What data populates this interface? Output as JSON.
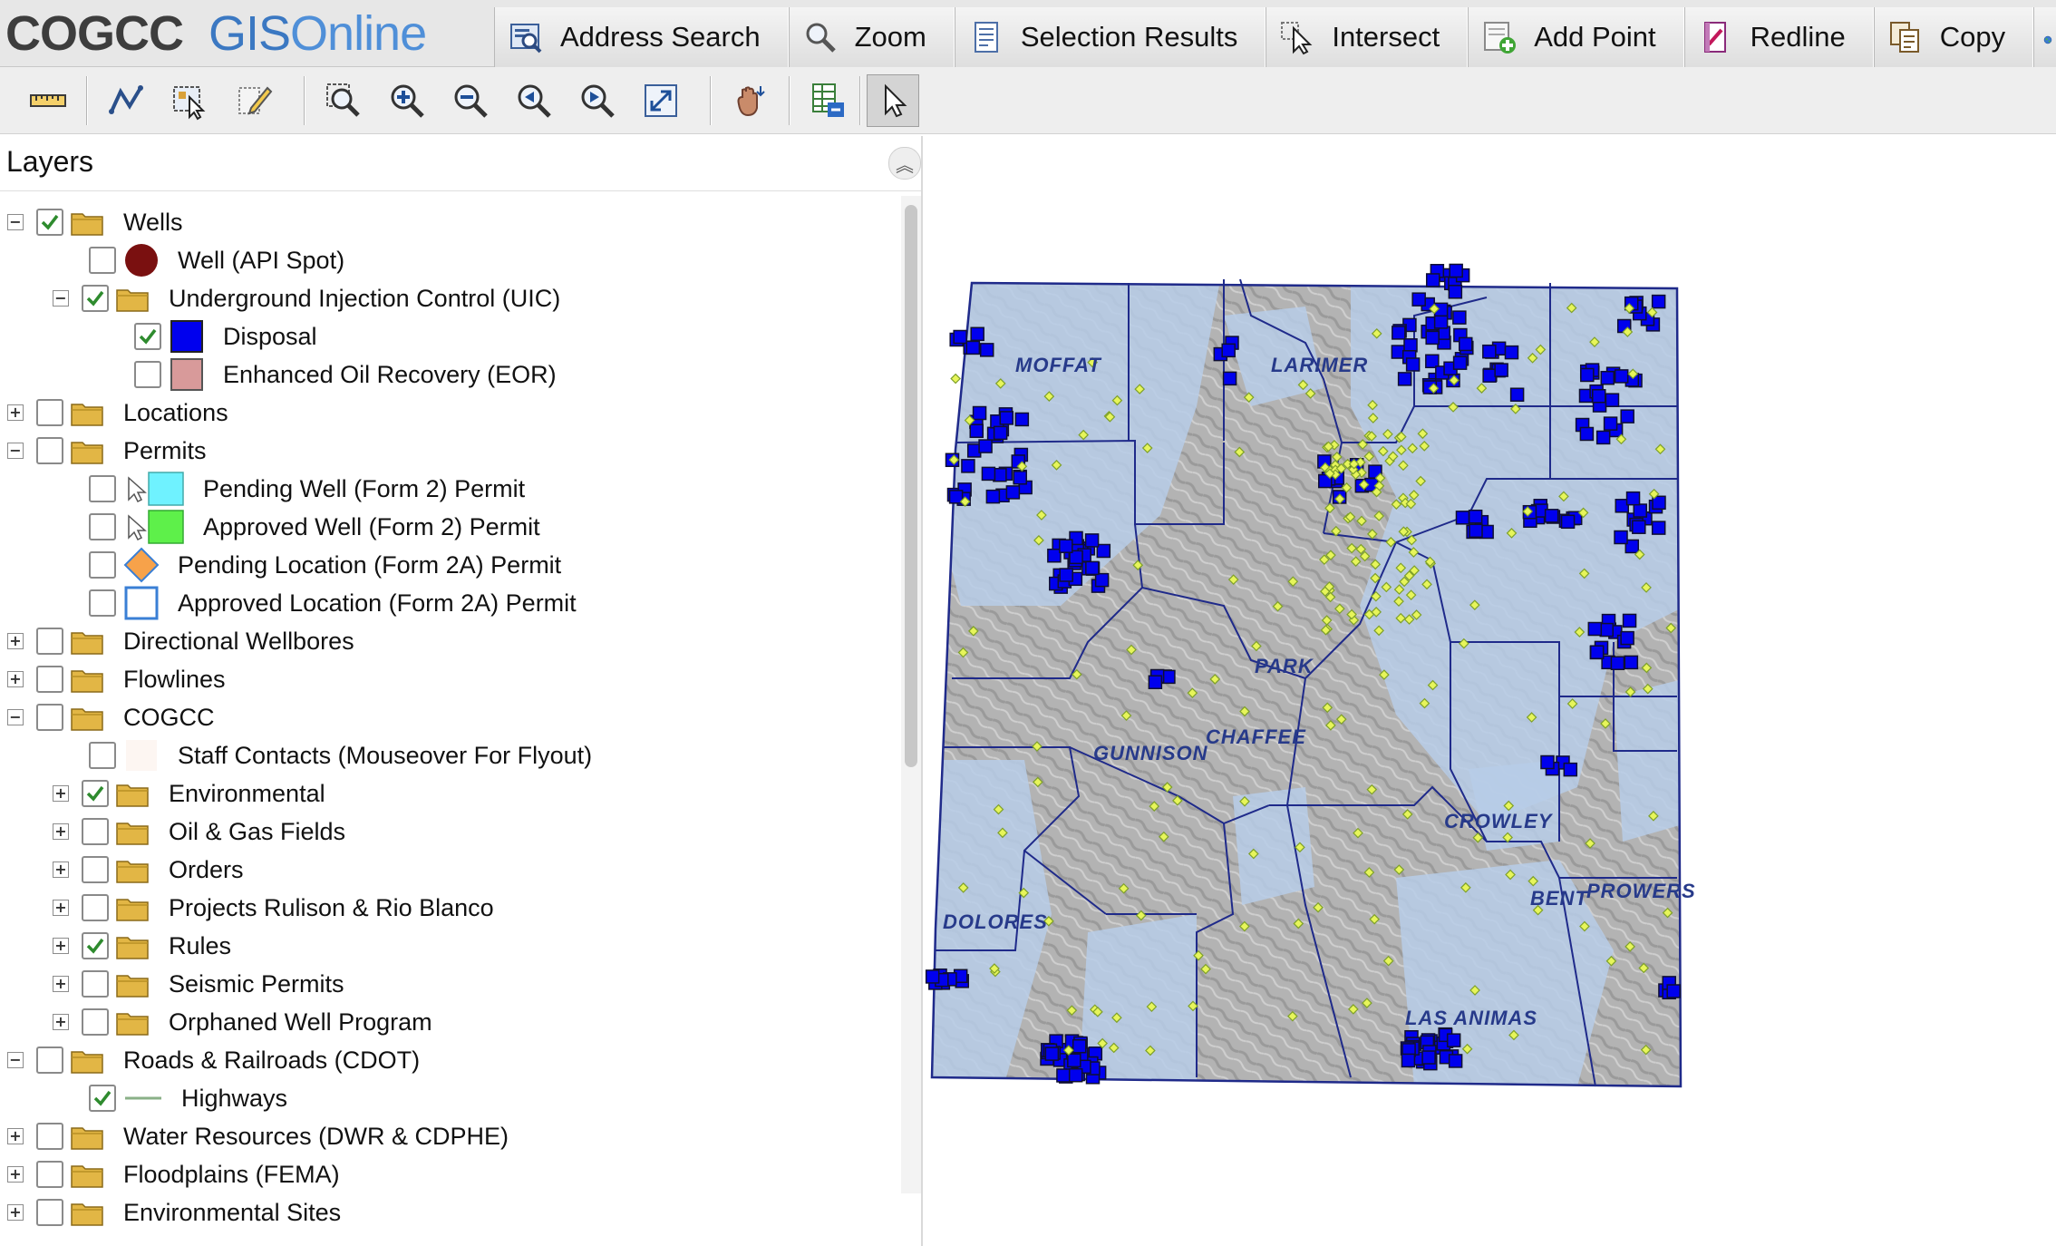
{
  "app": {
    "logo_part1": "COGCC",
    "logo_part2": "GIS",
    "logo_part3": "Online"
  },
  "menu": [
    {
      "label": "Address Search",
      "icon": "address-search-icon"
    },
    {
      "label": "Zoom",
      "icon": "magnifier-icon"
    },
    {
      "label": "Selection Results",
      "icon": "results-list-icon"
    },
    {
      "label": "Intersect",
      "icon": "intersect-cursor-icon"
    },
    {
      "label": "Add Point",
      "icon": "add-point-icon"
    },
    {
      "label": "Redline",
      "icon": "redline-icon"
    },
    {
      "label": "Copy",
      "icon": "copy-icon"
    }
  ],
  "toolbar_tools": [
    "measure-ruler-icon",
    "draw-polyline-icon",
    "select-features-icon",
    "edit-features-icon",
    "zoom-box-icon",
    "zoom-in-icon",
    "zoom-out-icon",
    "zoom-previous-icon",
    "zoom-next-icon",
    "full-extent-icon",
    "pan-hand-icon",
    "identify-table-icon",
    "pointer-arrow-icon"
  ],
  "layers_panel": {
    "title": "Layers",
    "tree": [
      {
        "label": "Wells",
        "level": 0,
        "type": "folder",
        "expander": "−",
        "checked": true
      },
      {
        "label": "Well (API Spot)",
        "level": 1,
        "type": "symbol",
        "symbol": "well-spot",
        "checked": false
      },
      {
        "label": "Underground Injection Control (UIC)",
        "level": 1,
        "type": "folder",
        "expander": "−",
        "checked": true
      },
      {
        "label": "Disposal",
        "level": 2,
        "type": "symbol",
        "symbol": "disposal",
        "checked": true
      },
      {
        "label": "Enhanced Oil Recovery (EOR)",
        "level": 2,
        "type": "symbol",
        "symbol": "eor",
        "checked": false
      },
      {
        "label": "Locations",
        "level": 0,
        "type": "folder",
        "expander": "+",
        "checked": false
      },
      {
        "label": "Permits",
        "level": 0,
        "type": "folder",
        "expander": "−",
        "checked": false
      },
      {
        "label": "Pending Well (Form 2) Permit",
        "level": 1,
        "type": "symbol",
        "symbol": "pending-well",
        "checked": false
      },
      {
        "label": "Approved Well (Form 2) Permit",
        "level": 1,
        "type": "symbol",
        "symbol": "approved-well",
        "checked": false
      },
      {
        "label": "Pending Location (Form 2A) Permit",
        "level": 1,
        "type": "symbol",
        "symbol": "pending-location",
        "checked": false
      },
      {
        "label": "Approved Location (Form 2A) Permit",
        "level": 1,
        "type": "symbol",
        "symbol": "approved-location",
        "checked": false
      },
      {
        "label": "Directional Wellbores",
        "level": 0,
        "type": "folder",
        "expander": "+",
        "checked": false
      },
      {
        "label": "Flowlines",
        "level": 0,
        "type": "folder",
        "expander": "+",
        "checked": false
      },
      {
        "label": "COGCC",
        "level": 0,
        "type": "folder",
        "expander": "−",
        "checked": false
      },
      {
        "label": "Staff Contacts (Mouseover For Flyout)",
        "level": 1,
        "type": "symbol",
        "symbol": "staff",
        "checked": false
      },
      {
        "label": "Environmental",
        "level": 1,
        "type": "folder",
        "expander": "+",
        "checked": true
      },
      {
        "label": "Oil & Gas Fields",
        "level": 1,
        "type": "folder",
        "expander": "+",
        "checked": false
      },
      {
        "label": "Orders",
        "level": 1,
        "type": "folder",
        "expander": "+",
        "checked": false
      },
      {
        "label": "Projects Rulison & Rio Blanco",
        "level": 1,
        "type": "folder",
        "expander": "+",
        "checked": false
      },
      {
        "label": "Rules",
        "level": 1,
        "type": "folder",
        "expander": "+",
        "checked": true
      },
      {
        "label": "Seismic Permits",
        "level": 1,
        "type": "folder",
        "expander": "+",
        "checked": false
      },
      {
        "label": "Orphaned Well Program",
        "level": 1,
        "type": "folder",
        "expander": "+",
        "checked": false
      },
      {
        "label": "Roads & Railroads (CDOT)",
        "level": 0,
        "type": "folder",
        "expander": "−",
        "checked": false
      },
      {
        "label": "Highways",
        "level": 1,
        "type": "symbol",
        "symbol": "highway",
        "checked": true
      },
      {
        "label": "Water Resources (DWR & CDPHE)",
        "level": 0,
        "type": "folder",
        "expander": "+",
        "checked": false
      },
      {
        "label": "Floodplains (FEMA)",
        "level": 0,
        "type": "folder",
        "expander": "+",
        "checked": false
      },
      {
        "label": "Environmental Sites",
        "level": 0,
        "type": "folder",
        "expander": "+",
        "checked": false
      }
    ]
  },
  "map": {
    "county_labels": [
      {
        "name": "MOFFAT"
      },
      {
        "name": "LARIMER"
      },
      {
        "name": "PARK"
      },
      {
        "name": "GUNNISON"
      },
      {
        "name": "CHAFFEE"
      },
      {
        "name": "CROWLEY"
      },
      {
        "name": "BENT"
      },
      {
        "name": "PROWERS"
      },
      {
        "name": "DOLORES"
      },
      {
        "name": "LAS ANIMAS"
      }
    ]
  },
  "colors": {
    "disposal": "#0000ee",
    "eor": "#d89a9a",
    "well_spot": "#7a1010",
    "pending_well": "#6ff2ff",
    "approved_well": "#5ef04a",
    "pending_location": "#f7a24a",
    "approved_location_border": "#3a7fd5",
    "county_lines": "#1f2a8a",
    "basin_fill": "#b7cde8",
    "terrain": "#b3b3b3",
    "check": "#2e8b2e",
    "label": "#273a8a"
  }
}
